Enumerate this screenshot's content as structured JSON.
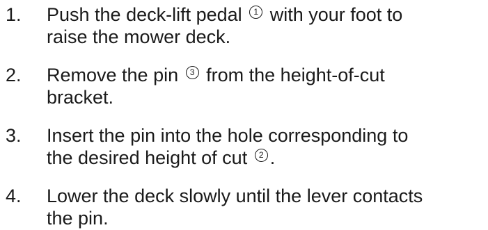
{
  "steps": [
    {
      "number": "1.",
      "before": "Push the deck-lift pedal",
      "callout": "1",
      "after": "with your foot to",
      "line2": "raise the mower deck."
    },
    {
      "number": "2.",
      "before": "Remove the pin",
      "callout": "3",
      "after": "from the height-of-cut",
      "line2": "bracket."
    },
    {
      "number": "3.",
      "line1": "Insert the pin into the hole corresponding to",
      "before": "the desired height of cut",
      "callout": "2",
      "after": "."
    },
    {
      "number": "4.",
      "line1": "Lower the deck slowly until the lever contacts",
      "line2": "the pin."
    }
  ]
}
